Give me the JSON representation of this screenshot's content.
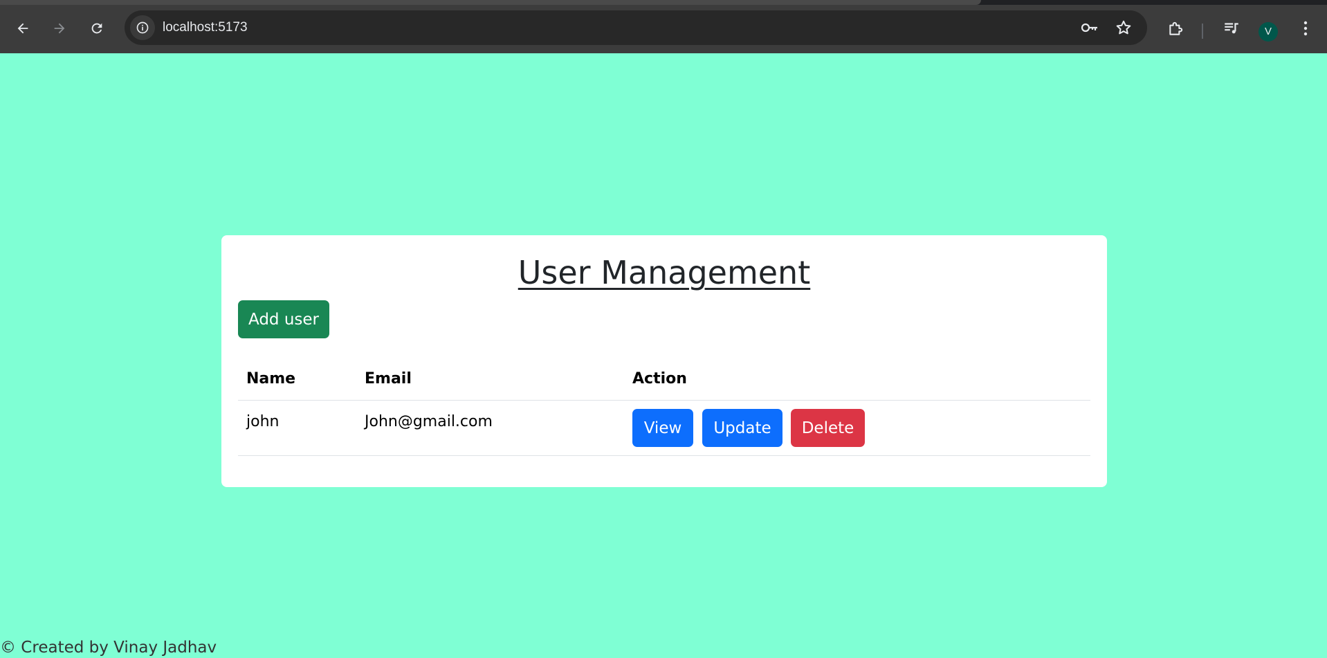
{
  "browser": {
    "url": "localhost:5173",
    "profile_initial": "V",
    "icons": {
      "back": "back-arrow-icon",
      "forward": "forward-arrow-icon",
      "reload": "reload-icon",
      "site_info": "info-icon",
      "password": "key-icon",
      "bookmark": "star-icon",
      "extensions": "puzzle-icon",
      "media": "playlist-icon",
      "menu": "kebab-menu-icon"
    },
    "colors": {
      "frame": "#3c3c3c",
      "omnibox": "#282828",
      "avatar": "#00574b"
    }
  },
  "page": {
    "background": "#7fffd4",
    "title": "User Management",
    "add_button_label": "Add user",
    "table": {
      "columns": [
        "Name",
        "Email",
        "Action"
      ],
      "rows": [
        {
          "name": "john",
          "email": "John@gmail.com",
          "actions": {
            "view": "View",
            "update": "Update",
            "delete": "Delete"
          }
        }
      ]
    },
    "colors": {
      "add": "#198754",
      "view": "#0d6efd",
      "update": "#0d6efd",
      "delete": "#dc3545"
    },
    "footer": "© Created by Vinay Jadhav"
  }
}
